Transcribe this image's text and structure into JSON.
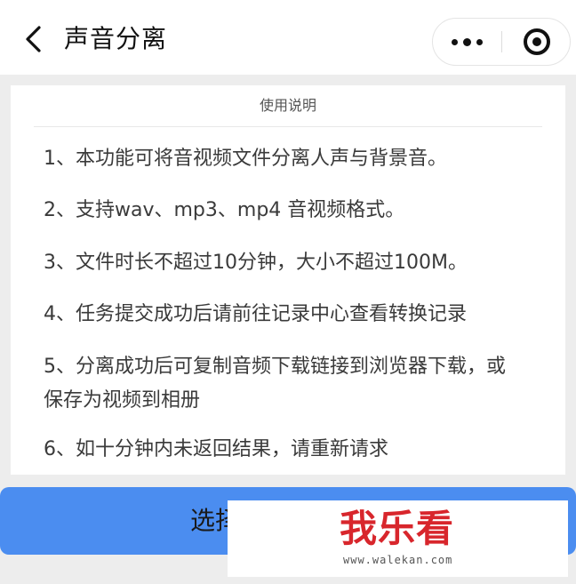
{
  "nav": {
    "title": "声音分离",
    "back_icon": "back-chevron-icon",
    "more_icon": "more-dots-icon",
    "close_icon": "capsule-close-icon"
  },
  "instructions": {
    "title": "使用说明",
    "items": [
      "1、本功能可将音视频文件分离人声与背景音。",
      "2、支持wav、mp3、mp4 音视频格式。",
      "3、文件时长不超过10分钟，大小不超过100M。",
      "4、任务提交成功后请前往记录中心查看转换记录",
      "5、分离成功后可复制音频下载链接到浏览器下载，或保存为视频到相册",
      "6、如十分钟内未返回结果，请重新请求"
    ]
  },
  "action": {
    "button_label": "选择"
  },
  "watermark": {
    "logo": "我乐看",
    "url": "www.walekan.com"
  },
  "colors": {
    "primary": "#4b8df0",
    "watermark_red": "#d8262c"
  }
}
